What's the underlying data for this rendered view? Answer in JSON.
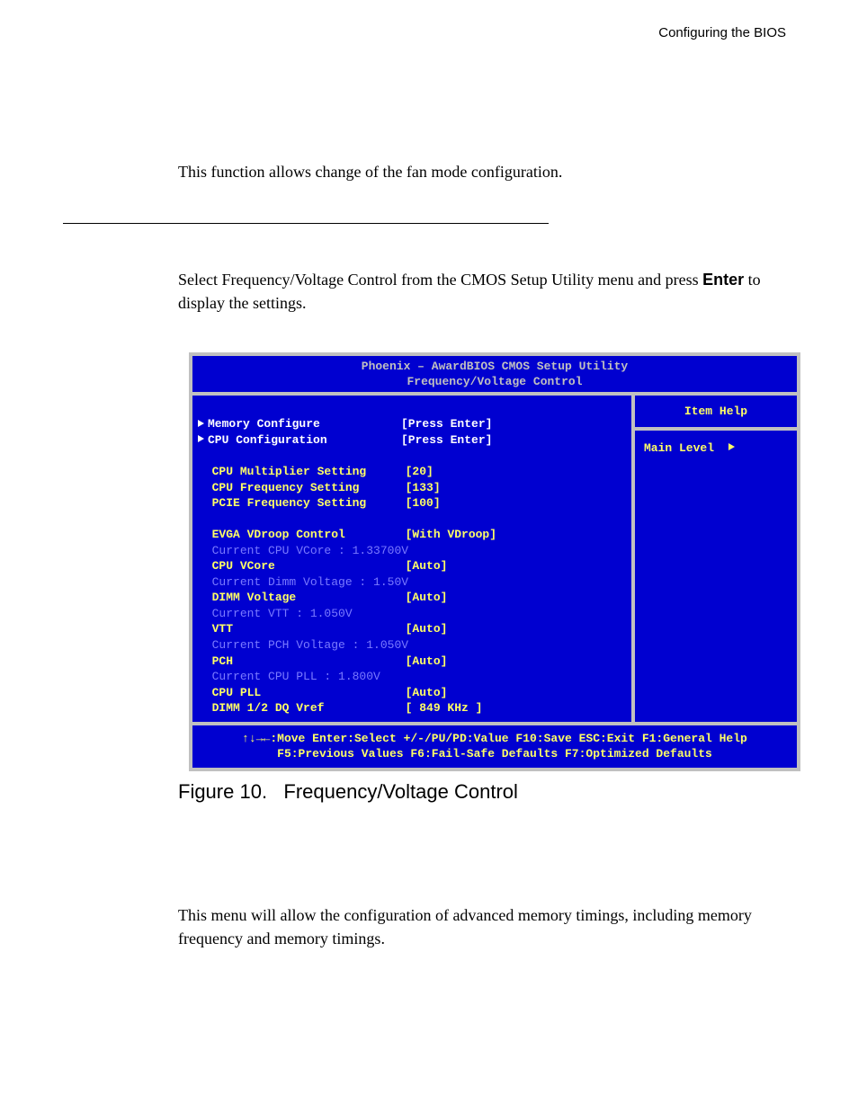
{
  "header": {
    "running_head": "Configuring the BIOS"
  },
  "para1": "This function allows change of the fan mode configuration.",
  "para2": {
    "line1": "Select Frequency/Voltage Control from the CMOS Setup Utility menu and press ",
    "enter_bold": "Enter",
    "line2": " to display the settings."
  },
  "bios": {
    "title_line1": "Phoenix – AwardBIOS CMOS Setup Utility",
    "title_line2": "Frequency/Voltage Control",
    "help_title": "Item Help",
    "main_level": "Main Level",
    "rows": {
      "mem_cfg_label": "Memory Configure",
      "mem_cfg_value": "[Press Enter]",
      "cpu_cfg_label": "CPU Configuration",
      "cpu_cfg_value": "[Press Enter]",
      "cpu_mult_label": "CPU Multiplier Setting",
      "cpu_mult_value": "[20]",
      "cpu_freq_label": "CPU Frequency Setting",
      "cpu_freq_value": "[133]",
      "pcie_freq_label": "PCIE Frequency Setting",
      "pcie_freq_value": "[100]",
      "evga_vdroop_label": "EVGA VDroop Control",
      "evga_vdroop_value": "[With VDroop]",
      "curr_vcore": "Current CPU VCore : 1.33700V",
      "cpu_vcore_label": "CPU VCore",
      "cpu_vcore_value": "[Auto]",
      "curr_dimm": "Current Dimm Voltage : 1.50V",
      "dimm_v_label": "DIMM Voltage",
      "dimm_v_value": "[Auto]",
      "curr_vtt": "Current VTT : 1.050V",
      "vtt_label": "VTT",
      "vtt_value": "[Auto]",
      "curr_pch": "Current PCH Voltage : 1.050V",
      "pch_label": "PCH",
      "pch_value": "[Auto]",
      "curr_pll": "Current CPU PLL : 1.800V",
      "cpu_pll_label": "CPU PLL",
      "cpu_pll_value": "[Auto]",
      "dimm_dq_label": "DIMM 1/2 DQ Vref",
      "dimm_dq_value": "[ 849 KHz ]"
    },
    "footer_line1": "↑↓→←:Move  Enter:Select  +/-/PU/PD:Value  F10:Save  ESC:Exit  F1:General Help",
    "footer_line2": "F5:Previous Values  F6:Fail-Safe Defaults  F7:Optimized Defaults"
  },
  "figure": {
    "number": "Figure 10.",
    "title": "Frequency/Voltage Control"
  },
  "para3": "This menu will allow the configuration of advanced memory timings, including memory frequency and memory timings."
}
